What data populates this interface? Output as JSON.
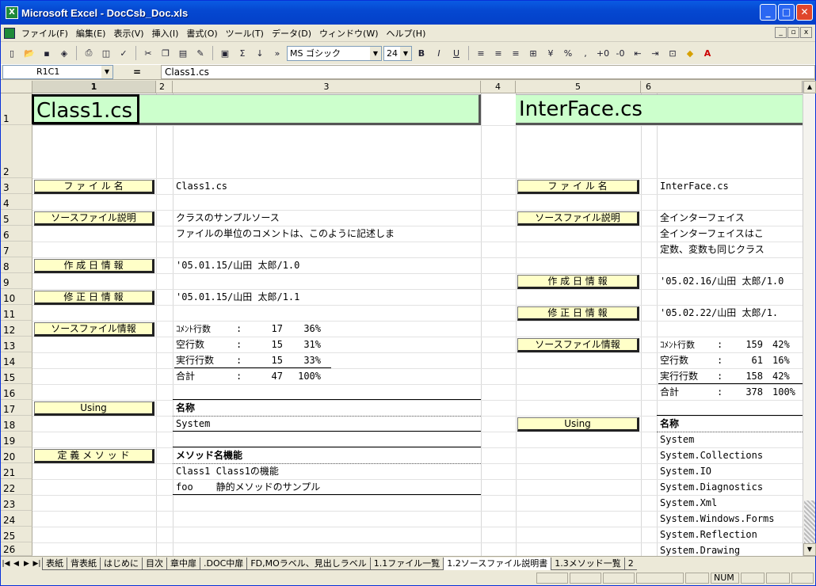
{
  "window": {
    "title": "Microsoft Excel - DocCsb_Doc.xls"
  },
  "menu": [
    "ファイル(F)",
    "編集(E)",
    "表示(V)",
    "挿入(I)",
    "書式(O)",
    "ツール(T)",
    "データ(D)",
    "ウィンドウ(W)",
    "ヘルプ(H)"
  ],
  "toolbar": {
    "font_name": "MS ゴシック",
    "font_size": "24"
  },
  "formula": {
    "name_box": "R1C1",
    "fx": "=",
    "value": "Class1.cs"
  },
  "columns": [
    "1",
    "2",
    "3",
    "4",
    "5",
    "6"
  ],
  "rows": [
    "1",
    "2",
    "3",
    "4",
    "5",
    "6",
    "7",
    "8",
    "9",
    "10",
    "11",
    "12",
    "13",
    "14",
    "15",
    "16",
    "17",
    "18",
    "19",
    "20",
    "21",
    "22",
    "23",
    "24",
    "25",
    "26"
  ],
  "left": {
    "title": "Class1.cs",
    "file_name_label": "フ ァ イ ル 名",
    "file_name": "Class1.cs",
    "desc_label": "ソースファイル説明",
    "desc1": "クラスのサンプルソース",
    "desc2": "ファイルの単位のコメントは、このように記述しま",
    "created_label": "作 成 日 情 報",
    "created": "'05.01.15/山田 太郎/1.0",
    "modified_label": "修 正 日 情 報",
    "modified": "'05.01.15/山田 太郎/1.1",
    "info_label": "ソースファイル情報",
    "stats": [
      {
        "name": "ｺﾒﾝﾄ行数",
        "sep": ":",
        "count": "17",
        "pct": "36%"
      },
      {
        "name": "空行数",
        "sep": ":",
        "count": "15",
        "pct": "31%"
      },
      {
        "name": "実行行数",
        "sep": ":",
        "count": "15",
        "pct": "33%"
      },
      {
        "name": "合計",
        "sep": ":",
        "count": "47",
        "pct": "100%"
      }
    ],
    "using_label": "Using",
    "using_header": "名称",
    "usings": [
      "System"
    ],
    "methods_label": "定 義 メ ソ ッ ド",
    "methods_header": "メソッド名機能",
    "methods": [
      "Class1 Class1の機能",
      "foo    静的メソッドのサンプル"
    ]
  },
  "right": {
    "title": "InterFace.cs",
    "file_name_label": "フ ァ イ ル 名",
    "file_name": "InterFace.cs",
    "desc_label": "ソースファイル説明",
    "desc1": "全インターフェイス",
    "desc2": "全インターフェイスはこ",
    "desc3": "定数、変数も同じクラス",
    "created_label": "作 成 日 情 報",
    "created": "'05.02.16/山田 太郎/1.0",
    "modified_label": "修 正 日 情 報",
    "modified": "'05.02.22/山田 太郎/1.",
    "info_label": "ソースファイル情報",
    "stats": [
      {
        "name": "ｺﾒﾝﾄ行数",
        "sep": ":",
        "count": "159",
        "pct": "42%"
      },
      {
        "name": "空行数",
        "sep": ":",
        "count": "61",
        "pct": "16%"
      },
      {
        "name": "実行行数",
        "sep": ":",
        "count": "158",
        "pct": "42%"
      },
      {
        "name": "合計",
        "sep": ":",
        "count": "378",
        "pct": "100%"
      }
    ],
    "using_label": "Using",
    "using_header": "名称",
    "usings": [
      "System",
      "System.Collections",
      "System.IO",
      "System.Diagnostics",
      "System.Xml",
      "System.Windows.Forms",
      "System.Reflection",
      "System.Drawing"
    ]
  },
  "tabs": [
    "表紙",
    "背表紙",
    "はじめに",
    "目次",
    "章中扉",
    ".DOC中扉",
    "FD,MOラベル、見出しラベル",
    "1.1ファイル一覧",
    "1.2ソースファイル説明書",
    "1.3メソッド一覧",
    "2"
  ],
  "active_tab": "1.2ソースファイル説明書",
  "status": {
    "num": "NUM"
  }
}
